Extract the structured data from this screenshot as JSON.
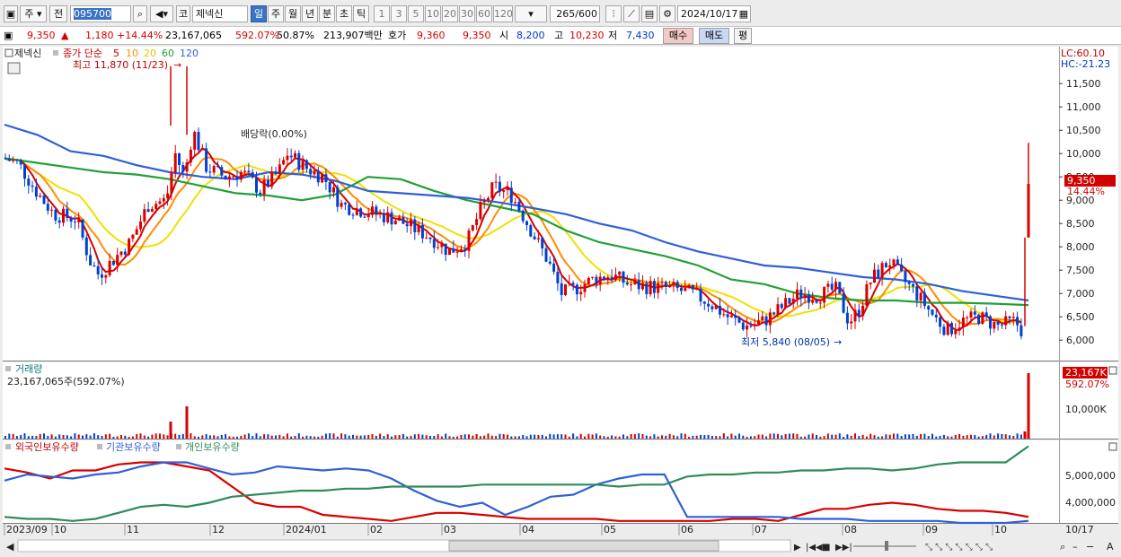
{
  "toolbar": {
    "market": "주",
    "period_prev": "전",
    "code": "095700",
    "name_prefix": "코",
    "name": "제넥신",
    "period_tabs": [
      "일",
      "주",
      "월",
      "년",
      "분",
      "초",
      "틱"
    ],
    "active_period": "일",
    "intervals": [
      "1",
      "3",
      "5",
      "10",
      "20",
      "30",
      "60",
      "120"
    ],
    "count": "265",
    "count_total": "/600",
    "date": "2024/10/17"
  },
  "quote": {
    "price": "9,350",
    "change": "1,180",
    "change_pct": "+14.44%",
    "volume": "23,167,065",
    "vol_ratio": "592.07%",
    "turnover_rate": "50.87%",
    "amount": "213,907백만",
    "ask_label": "호가",
    "ask1": "9,360",
    "ask2": "9,350",
    "open_label": "시",
    "open": "8,200",
    "high_label": "고",
    "high": "10,230",
    "low_label": "저",
    "low": "7,430",
    "buy": "매수",
    "sell": "매도",
    "even": "평"
  },
  "price_panel": {
    "name": "제넥신",
    "ma_label": "종가 단순",
    "ma_periods": [
      "5",
      "10",
      "20",
      "60",
      "120"
    ],
    "high_note": "최고 11,870 (11/23)",
    "low_note": "최저 5,840 (08/05)",
    "dividend_note": "배당락(0.00%)",
    "lc": "LC:60.10",
    "hc": "HC:-21.23",
    "current_tag": "9,350",
    "current_pct": "14.44%",
    "y_ticks": [
      "11,500",
      "11,000",
      "10,500",
      "10,000",
      "9,500",
      "9,000",
      "8,500",
      "8,000",
      "7,500",
      "7,000",
      "6,500",
      "6,000"
    ]
  },
  "volume_panel": {
    "title": "거래량",
    "info": "23,167,065주(592.07%)",
    "tag": "23,167K",
    "tag_pct": "592.07%",
    "y_tick": "10,000K"
  },
  "holding_panel": {
    "legend": [
      "외국인보유수량",
      "기관보유수량",
      "개인보유수량"
    ],
    "y_ticks": [
      "5,000,000",
      "4,000,000"
    ]
  },
  "x_axis": {
    "labels": [
      "2023/09",
      "10",
      "11",
      "12",
      "2024/01",
      "02",
      "03",
      "04",
      "05",
      "06",
      "07",
      "08",
      "09",
      "10"
    ],
    "end_label": "10/17"
  },
  "colors": {
    "up": "#d80000",
    "down": "#0040d0",
    "ma5": "#d80000",
    "ma10": "#ff8c00",
    "ma20": "#f0e000",
    "ma60": "#22a038",
    "ma120": "#2f5fd8",
    "foreign": "#d80000",
    "institution": "#2f5fd8",
    "individual": "#2e8b57"
  },
  "chart_data": {
    "type": "candlestick",
    "series_ma120": [
      10.62,
      10.4,
      10.05,
      9.95,
      9.75,
      9.6,
      9.5,
      9.45,
      9.6,
      9.55,
      9.42,
      9.2,
      9.15,
      9.1,
      9.05,
      8.95,
      8.83,
      8.7,
      8.5,
      8.35,
      8.1,
      7.9,
      7.75,
      7.6,
      7.55,
      7.45,
      7.35,
      7.3,
      7.2,
      7.05,
      6.95,
      6.85
    ],
    "series_ma60": [
      9.9,
      9.8,
      9.7,
      9.6,
      9.55,
      9.45,
      9.3,
      9.15,
      9.1,
      9.0,
      9.12,
      9.5,
      9.45,
      9.2,
      9.0,
      8.85,
      8.7,
      8.35,
      8.1,
      7.95,
      7.8,
      7.6,
      7.3,
      7.2,
      7.0,
      6.9,
      6.85,
      6.85,
      6.8,
      6.8,
      6.78,
      6.75
    ]
  }
}
